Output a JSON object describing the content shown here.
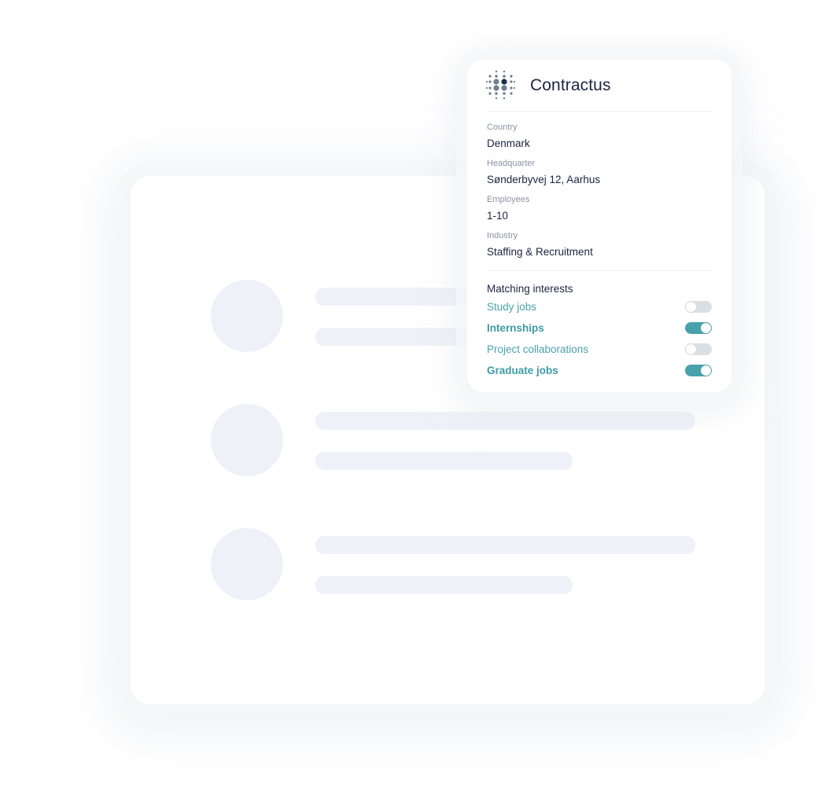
{
  "company": {
    "name": "Contractus",
    "logo_icon": "dot-grid-logo-icon"
  },
  "details": [
    {
      "label": "Country",
      "value": "Denmark"
    },
    {
      "label": "Headquarter",
      "value": "Sønderbyvej 12, Aarhus"
    },
    {
      "label": "Employees",
      "value": "1-10"
    },
    {
      "label": "Industry",
      "value": "Staffing & Recruitment"
    }
  ],
  "interests": {
    "title": "Matching interests",
    "items": [
      {
        "label": "Study jobs",
        "enabled": false
      },
      {
        "label": "Internships",
        "enabled": true
      },
      {
        "label": "Project collaborations",
        "enabled": false
      },
      {
        "label": "Graduate jobs",
        "enabled": true
      }
    ]
  },
  "colors": {
    "accent": "#48a2ab",
    "text_primary": "#1c2440",
    "text_muted": "#8a93a3",
    "placeholder": "#eef1f8",
    "toggle_off": "#dadfe4",
    "logo_dark": "#1f2a4d",
    "logo_gray": "#6f7f8f"
  },
  "background_list": {
    "rows": 3
  }
}
